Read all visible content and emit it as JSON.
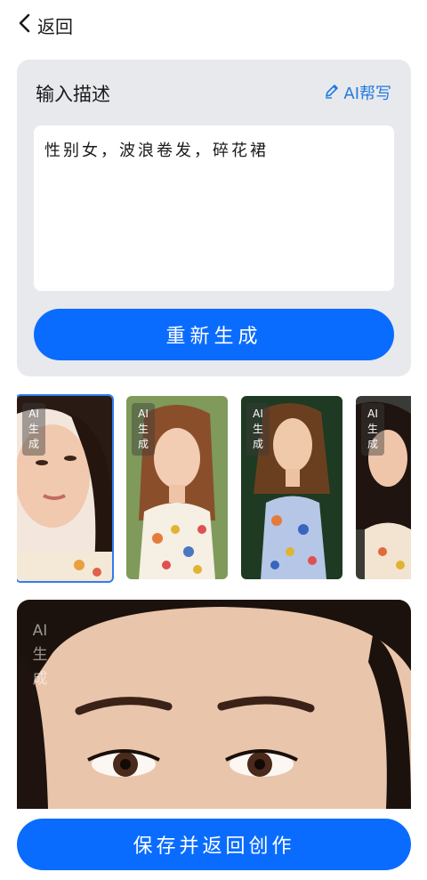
{
  "header": {
    "back_label": "返回",
    "back_icon": "chevron-left-icon"
  },
  "describe": {
    "title": "输入描述",
    "ai_help_label": "AI帮写",
    "ai_help_icon": "pen-icon",
    "text": "性别女，波浪卷发，碎花裙",
    "regenerate_label": "重新生成"
  },
  "thumbnails": [
    {
      "selected": true,
      "watermark": [
        "AI",
        "生",
        "成"
      ]
    },
    {
      "selected": false,
      "watermark": [
        "AI",
        "生",
        "成"
      ]
    },
    {
      "selected": false,
      "watermark": [
        "AI",
        "生",
        "成"
      ]
    },
    {
      "selected": false,
      "watermark": [
        "AI",
        "生",
        "成"
      ]
    }
  ],
  "preview": {
    "watermark": [
      "AI",
      "生",
      "成"
    ]
  },
  "footer": {
    "save_label": "保存并返回创作"
  },
  "colors": {
    "primary": "#0a6cff",
    "accent_text": "#1f7ae0",
    "card_bg": "#e8e9ed",
    "selected_border": "#2f7df0"
  }
}
